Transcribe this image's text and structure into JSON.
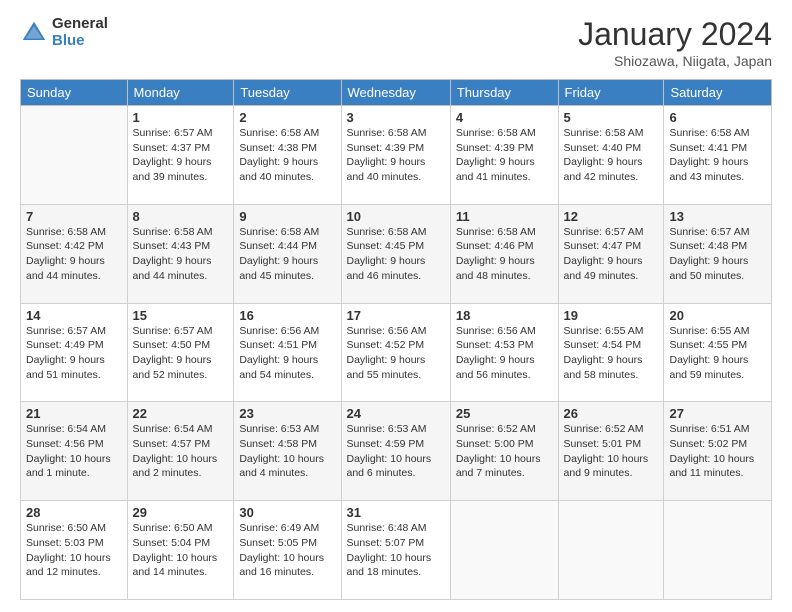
{
  "header": {
    "logo_general": "General",
    "logo_blue": "Blue",
    "title": "January 2024",
    "location": "Shiozawa, Niigata, Japan"
  },
  "days_of_week": [
    "Sunday",
    "Monday",
    "Tuesday",
    "Wednesday",
    "Thursday",
    "Friday",
    "Saturday"
  ],
  "weeks": [
    [
      {
        "day": "",
        "info": ""
      },
      {
        "day": "1",
        "info": "Sunrise: 6:57 AM\nSunset: 4:37 PM\nDaylight: 9 hours\nand 39 minutes."
      },
      {
        "day": "2",
        "info": "Sunrise: 6:58 AM\nSunset: 4:38 PM\nDaylight: 9 hours\nand 40 minutes."
      },
      {
        "day": "3",
        "info": "Sunrise: 6:58 AM\nSunset: 4:39 PM\nDaylight: 9 hours\nand 40 minutes."
      },
      {
        "day": "4",
        "info": "Sunrise: 6:58 AM\nSunset: 4:39 PM\nDaylight: 9 hours\nand 41 minutes."
      },
      {
        "day": "5",
        "info": "Sunrise: 6:58 AM\nSunset: 4:40 PM\nDaylight: 9 hours\nand 42 minutes."
      },
      {
        "day": "6",
        "info": "Sunrise: 6:58 AM\nSunset: 4:41 PM\nDaylight: 9 hours\nand 43 minutes."
      }
    ],
    [
      {
        "day": "7",
        "info": "Sunrise: 6:58 AM\nSunset: 4:42 PM\nDaylight: 9 hours\nand 44 minutes."
      },
      {
        "day": "8",
        "info": "Sunrise: 6:58 AM\nSunset: 4:43 PM\nDaylight: 9 hours\nand 44 minutes."
      },
      {
        "day": "9",
        "info": "Sunrise: 6:58 AM\nSunset: 4:44 PM\nDaylight: 9 hours\nand 45 minutes."
      },
      {
        "day": "10",
        "info": "Sunrise: 6:58 AM\nSunset: 4:45 PM\nDaylight: 9 hours\nand 46 minutes."
      },
      {
        "day": "11",
        "info": "Sunrise: 6:58 AM\nSunset: 4:46 PM\nDaylight: 9 hours\nand 48 minutes."
      },
      {
        "day": "12",
        "info": "Sunrise: 6:57 AM\nSunset: 4:47 PM\nDaylight: 9 hours\nand 49 minutes."
      },
      {
        "day": "13",
        "info": "Sunrise: 6:57 AM\nSunset: 4:48 PM\nDaylight: 9 hours\nand 50 minutes."
      }
    ],
    [
      {
        "day": "14",
        "info": "Sunrise: 6:57 AM\nSunset: 4:49 PM\nDaylight: 9 hours\nand 51 minutes."
      },
      {
        "day": "15",
        "info": "Sunrise: 6:57 AM\nSunset: 4:50 PM\nDaylight: 9 hours\nand 52 minutes."
      },
      {
        "day": "16",
        "info": "Sunrise: 6:56 AM\nSunset: 4:51 PM\nDaylight: 9 hours\nand 54 minutes."
      },
      {
        "day": "17",
        "info": "Sunrise: 6:56 AM\nSunset: 4:52 PM\nDaylight: 9 hours\nand 55 minutes."
      },
      {
        "day": "18",
        "info": "Sunrise: 6:56 AM\nSunset: 4:53 PM\nDaylight: 9 hours\nand 56 minutes."
      },
      {
        "day": "19",
        "info": "Sunrise: 6:55 AM\nSunset: 4:54 PM\nDaylight: 9 hours\nand 58 minutes."
      },
      {
        "day": "20",
        "info": "Sunrise: 6:55 AM\nSunset: 4:55 PM\nDaylight: 9 hours\nand 59 minutes."
      }
    ],
    [
      {
        "day": "21",
        "info": "Sunrise: 6:54 AM\nSunset: 4:56 PM\nDaylight: 10 hours\nand 1 minute."
      },
      {
        "day": "22",
        "info": "Sunrise: 6:54 AM\nSunset: 4:57 PM\nDaylight: 10 hours\nand 2 minutes."
      },
      {
        "day": "23",
        "info": "Sunrise: 6:53 AM\nSunset: 4:58 PM\nDaylight: 10 hours\nand 4 minutes."
      },
      {
        "day": "24",
        "info": "Sunrise: 6:53 AM\nSunset: 4:59 PM\nDaylight: 10 hours\nand 6 minutes."
      },
      {
        "day": "25",
        "info": "Sunrise: 6:52 AM\nSunset: 5:00 PM\nDaylight: 10 hours\nand 7 minutes."
      },
      {
        "day": "26",
        "info": "Sunrise: 6:52 AM\nSunset: 5:01 PM\nDaylight: 10 hours\nand 9 minutes."
      },
      {
        "day": "27",
        "info": "Sunrise: 6:51 AM\nSunset: 5:02 PM\nDaylight: 10 hours\nand 11 minutes."
      }
    ],
    [
      {
        "day": "28",
        "info": "Sunrise: 6:50 AM\nSunset: 5:03 PM\nDaylight: 10 hours\nand 12 minutes."
      },
      {
        "day": "29",
        "info": "Sunrise: 6:50 AM\nSunset: 5:04 PM\nDaylight: 10 hours\nand 14 minutes."
      },
      {
        "day": "30",
        "info": "Sunrise: 6:49 AM\nSunset: 5:05 PM\nDaylight: 10 hours\nand 16 minutes."
      },
      {
        "day": "31",
        "info": "Sunrise: 6:48 AM\nSunset: 5:07 PM\nDaylight: 10 hours\nand 18 minutes."
      },
      {
        "day": "",
        "info": ""
      },
      {
        "day": "",
        "info": ""
      },
      {
        "day": "",
        "info": ""
      }
    ]
  ]
}
